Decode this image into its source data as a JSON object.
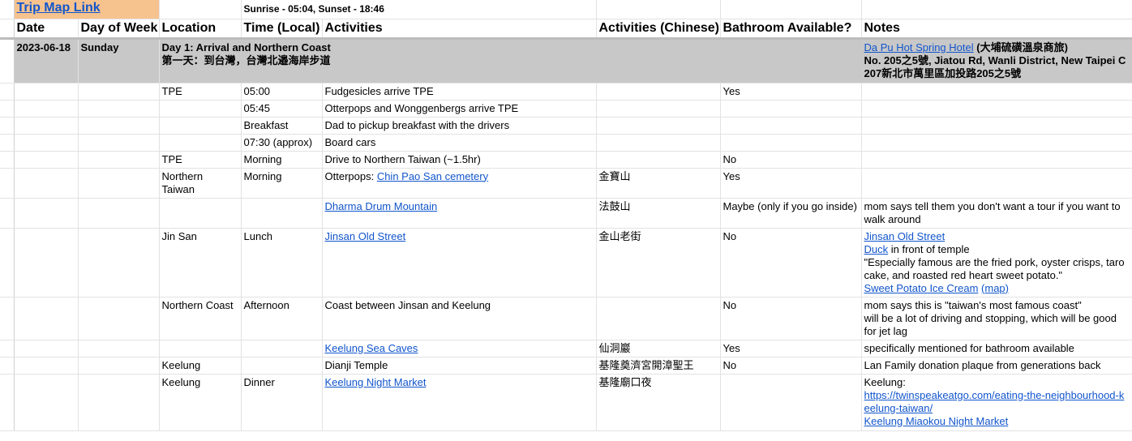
{
  "top": {
    "trip_link": "Trip Map Link",
    "sun_info": "Sunrise - 05:04, Sunset - 18:46"
  },
  "headers": {
    "date": "Date",
    "day_of_week": "Day of Week",
    "location": "Location",
    "time": "Time (Local)",
    "activities": "Activities",
    "activities_cn": "Activities (Chinese)",
    "bathroom": "Bathroom Available?",
    "notes": "Notes"
  },
  "day": {
    "date": "2023-06-18",
    "weekday": "Sunday",
    "title_en": "Day 1: Arrival and Northern Coast",
    "title_cn": "第一天：到台灣，台灣北邉海岸步道",
    "hotel_link": "Da Pu Hot Spring Hotel",
    "hotel_cn": " (大埔硫磺溫泉商旅)",
    "address_en": "No. 205之5號, Jiatou Rd, Wanli District, New Taipei C",
    "address_cn": "207新北市萬里區加投路205之5號"
  },
  "rows": {
    "r1": {
      "location": "TPE",
      "time": "05:00",
      "activity": "Fudgesicles arrive TPE",
      "bathroom": "Yes"
    },
    "r2": {
      "time": "05:45",
      "activity": "Otterpops and Wonggenbergs arrive TPE"
    },
    "r3": {
      "time": "Breakfast",
      "activity": "Dad to pickup breakfast with the drivers"
    },
    "r4": {
      "time": "07:30 (approx)",
      "activity": "Board cars"
    },
    "r5": {
      "location": "TPE",
      "time": "Morning",
      "activity": "Drive to Northern Taiwan (~1.5hr)",
      "bathroom": "No"
    },
    "r6": {
      "location": "Northern Taiwan",
      "time": "Morning",
      "activity_prefix": "Otterpops: ",
      "activity_link": "Chin Pao San cemetery",
      "activity_cn": "金寶山",
      "bathroom": "Yes"
    },
    "r7": {
      "activity_link": "Dharma Drum Mountain",
      "activity_cn": "法鼓山",
      "bathroom": "Maybe (only if you go inside)",
      "notes": "mom says tell them you don't want a tour if you want to walk around"
    },
    "r8": {
      "location": "Jin San",
      "time": "Lunch",
      "activity_link": "Jinsan Old Street",
      "activity_cn": "金山老街",
      "bathroom": "No",
      "notes_link1": "Jinsan Old Street",
      "notes_link2": "Duck",
      "notes_text2": " in front of temple",
      "notes_quote": "\"Especially famous are the fried pork, oyster crisps, taro cake, and roasted red heart sweet potato.\"",
      "notes_link3": "Sweet Potato Ice Cream",
      "notes_link4": "(map)"
    },
    "r9": {
      "location": "Northern Coast",
      "time": "Afternoon",
      "activity": "Coast between Jinsan and Keelung",
      "bathroom": "No",
      "notes": "mom says this is \"taiwan's most famous coast\"\nwill be a lot of driving and stopping, which will be good for jet lag"
    },
    "r10": {
      "activity_link": "Keelung Sea Caves",
      "activity_cn": "仙洞巖",
      "bathroom": "Yes",
      "notes": "specifically mentioned for bathroom available"
    },
    "r11": {
      "location": "Keelung",
      "activity": "Dianji Temple",
      "activity_cn": "基隆奠濟宮開漳聖王",
      "bathroom": "No",
      "notes": "Lan Family donation plaque from generations back"
    },
    "r12": {
      "location": "Keelung",
      "time": "Dinner",
      "activity_link": "Keelung Night Market",
      "activity_cn": "基隆廟口夜",
      "notes_text": "Keelung:",
      "notes_link1": "https://twinspeakeatgo.com/eating-the-neighbourhood-keelung-taiwan/",
      "notes_link2": "Keelung Miaokou Night Market"
    }
  }
}
